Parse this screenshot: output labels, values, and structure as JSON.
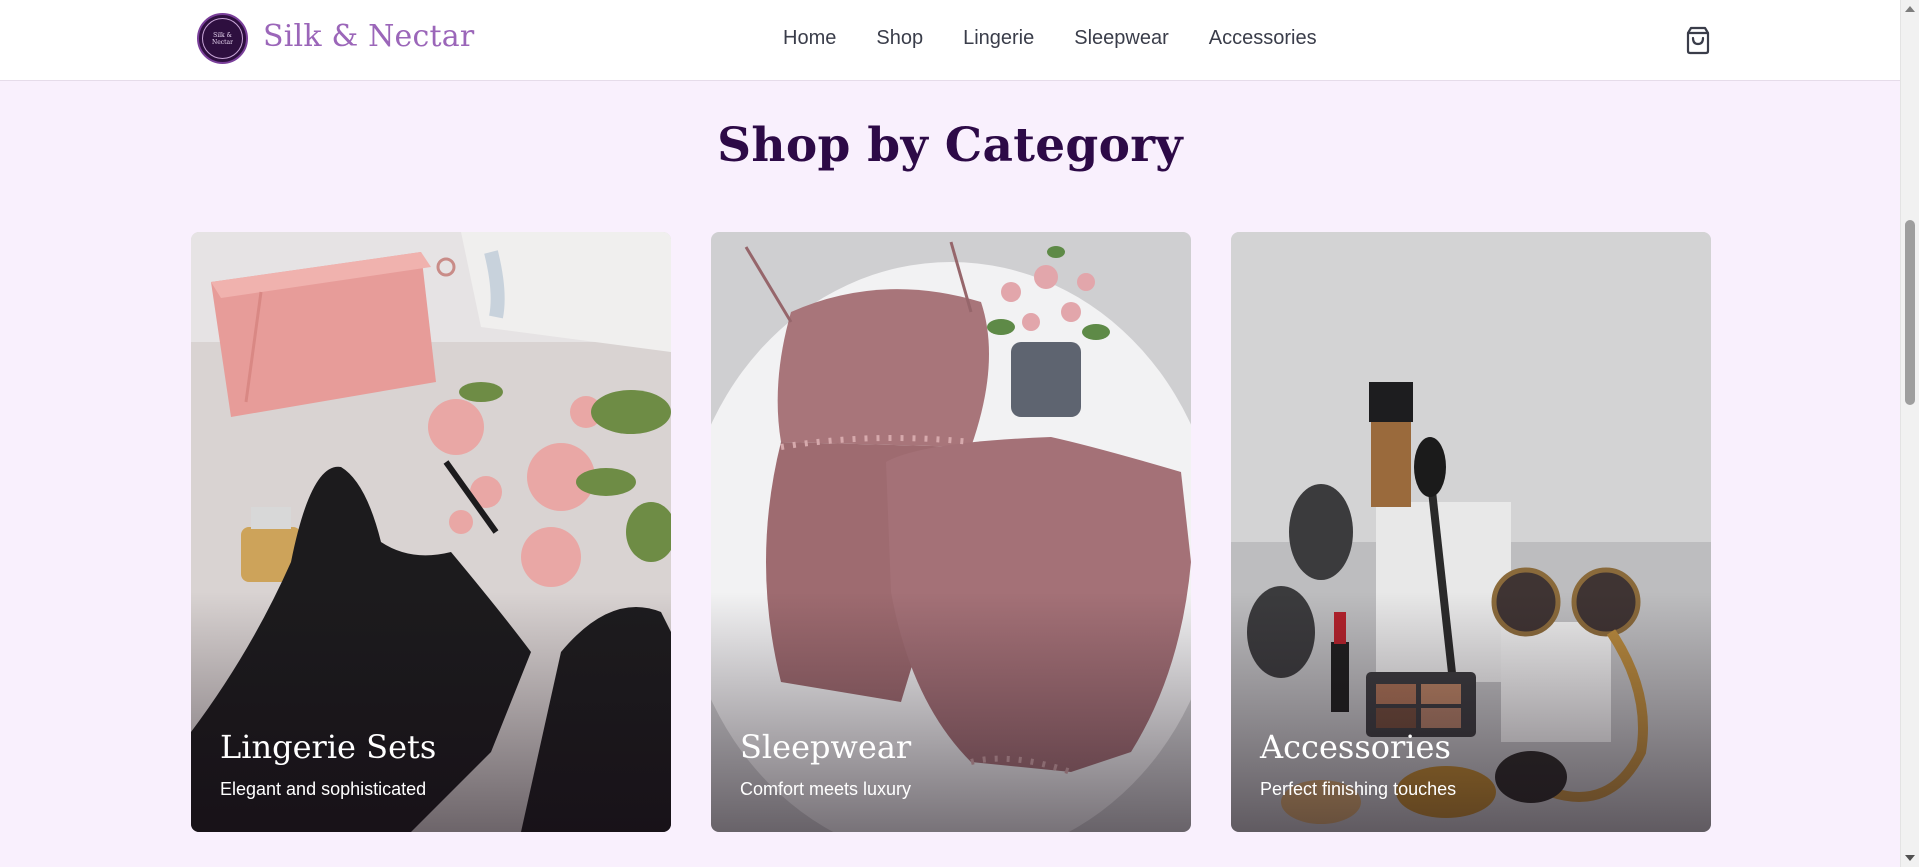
{
  "brand": {
    "name": "Silk & Nectar",
    "badge_text": "Silk & Nectar",
    "colors": {
      "brand": "#9b66b9",
      "badge": "#2e0f3f",
      "title": "#2d0a47",
      "background": "#f9f0fd"
    }
  },
  "nav": {
    "items": [
      {
        "label": "Home"
      },
      {
        "label": "Shop"
      },
      {
        "label": "Lingerie"
      },
      {
        "label": "Sleepwear"
      },
      {
        "label": "Accessories"
      }
    ],
    "cart_icon": "shopping-bag-icon"
  },
  "section": {
    "title": "Shop by Category"
  },
  "categories": [
    {
      "title": "Lingerie Sets",
      "subtitle": "Elegant and sophisticated",
      "image": "lingerie-flatlay"
    },
    {
      "title": "Sleepwear",
      "subtitle": "Comfort meets luxury",
      "image": "sleepwear-flatlay"
    },
    {
      "title": "Accessories",
      "subtitle": "Perfect finishing touches",
      "image": "accessories-flatlay"
    }
  ]
}
